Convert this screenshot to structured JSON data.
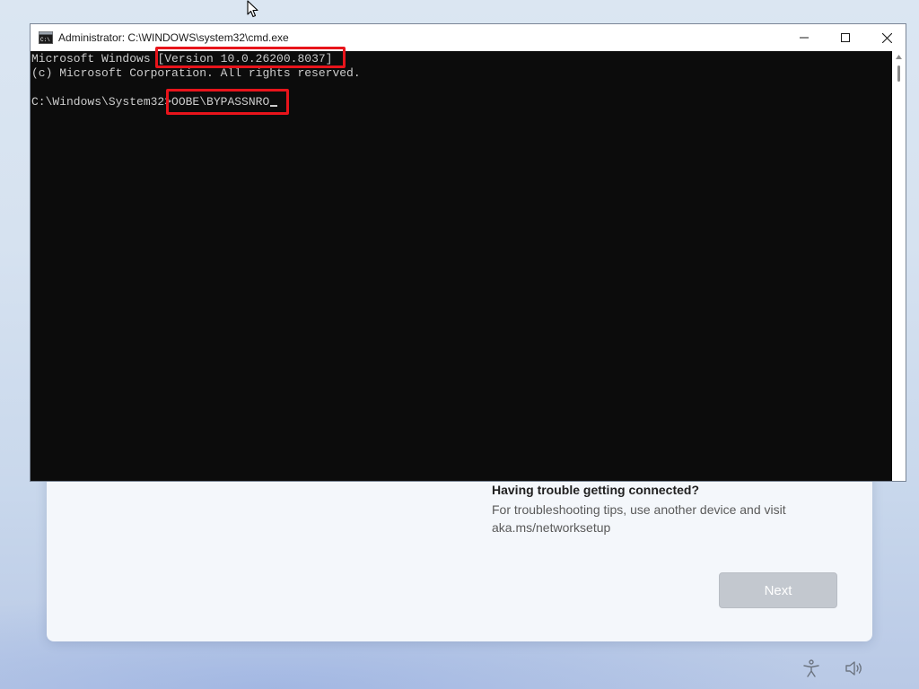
{
  "window": {
    "title": "Administrator: C:\\WINDOWS\\system32\\cmd.exe"
  },
  "console": {
    "line1_prefix": "Microsoft Windows ",
    "version": "[Version 10.0.26200.8037]",
    "line2": "(c) Microsoft Corporation. All rights reserved.",
    "prompt": "C:\\Windows\\System32>",
    "command": "OOBE\\BYPASSNRO"
  },
  "oobe": {
    "help_title": "Having trouble getting connected?",
    "help_text_line1": "For troubleshooting tips, use another device and visit",
    "help_text_line2": "aka.ms/networksetup",
    "next_label": "Next"
  },
  "icons": {
    "app": "cmd-icon",
    "minimize": "minimize-icon",
    "maximize": "maximize-icon",
    "close": "close-icon",
    "accessibility": "accessibility-icon",
    "volume": "volume-icon",
    "cursor": "mouse-cursor-icon"
  },
  "colors": {
    "console_bg": "#0c0c0c",
    "console_text": "#cccccc",
    "highlight": "#e8141b",
    "next_button_disabled": "#c3c8cf"
  }
}
